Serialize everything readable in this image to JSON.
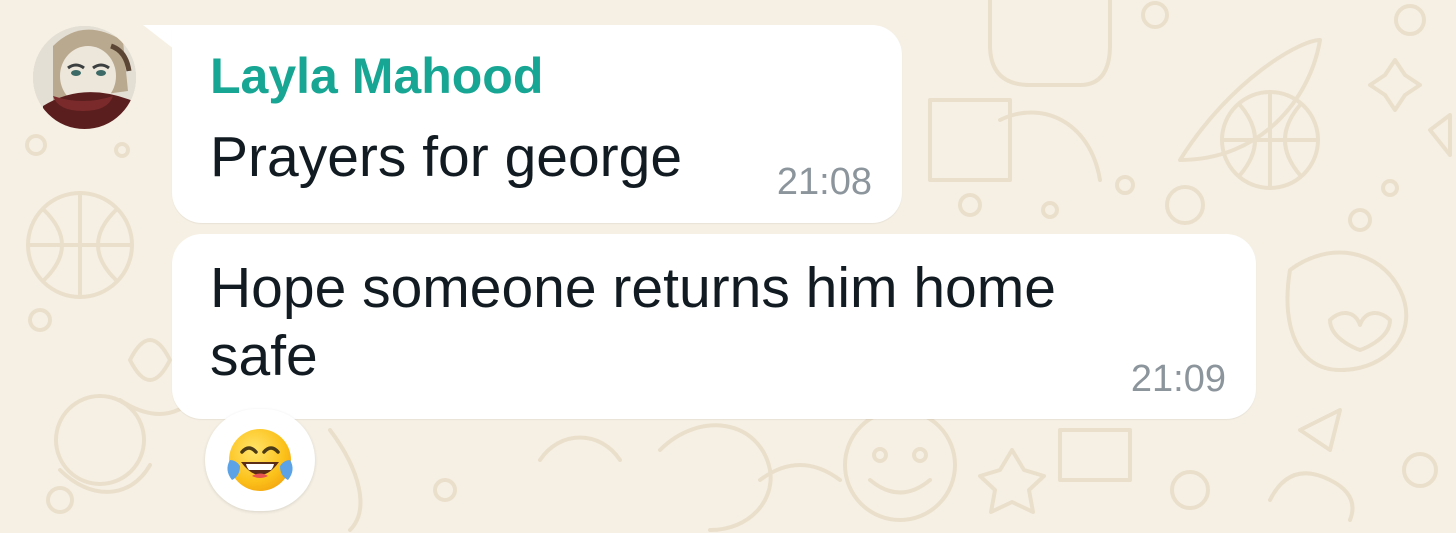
{
  "chat": {
    "sender": {
      "name": "Layla Mahood",
      "name_color": "#17a693",
      "avatar": "profile-photo"
    },
    "messages": [
      {
        "text": "Prayers for george",
        "time": "21:08"
      },
      {
        "lines": [
          "Hope someone returns him home",
          "safe"
        ],
        "time": "21:09"
      }
    ],
    "reaction": {
      "emoji": "face-with-tears-of-joy",
      "glyph": "😂"
    }
  },
  "colors": {
    "wallpaper": "#f6f0e4",
    "bubble": "#ffffff",
    "text": "#111b21",
    "timestamp": "#8c959c"
  }
}
